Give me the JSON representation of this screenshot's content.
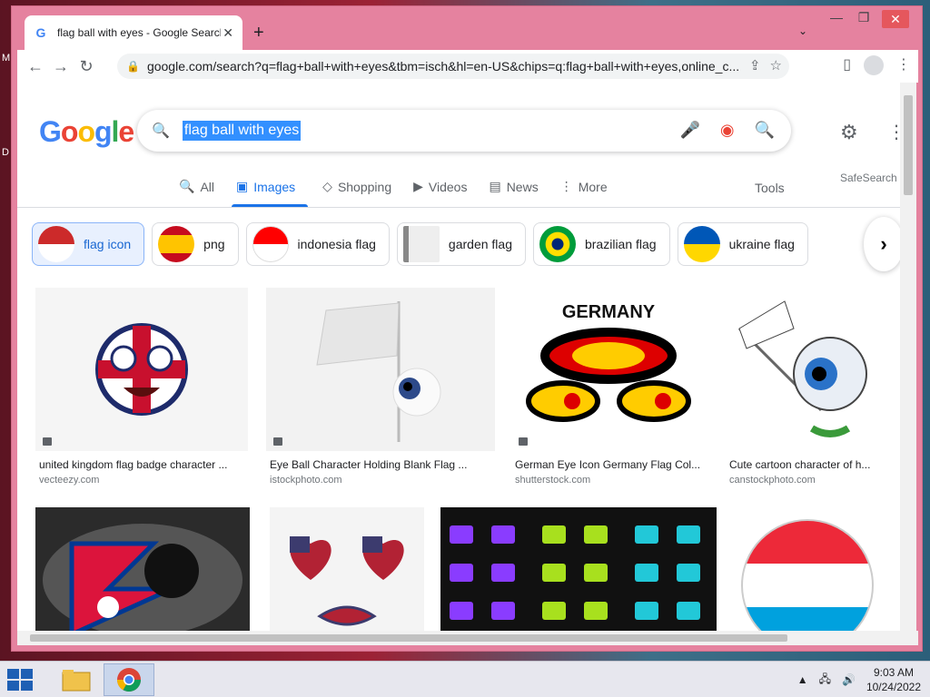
{
  "desktop": {
    "glyph_1": "M",
    "glyph_2": "D"
  },
  "browser": {
    "tab_title": "flag ball with eyes - Google Search",
    "tab_close": "✕",
    "new_tab": "+",
    "tab_search": "⌄",
    "window_controls": {
      "minimize": "—",
      "maximize": "❐",
      "close": "✕"
    },
    "nav": {
      "back": "←",
      "forward": "→",
      "reload": "↻"
    },
    "url": "google.com/search?q=flag+ball+with+eyes&tbm=isch&hl=en-US&chips=q:flag+ball+with+eyes,online_c...",
    "lock": "🔒",
    "omni_icons": [
      "⇪",
      "☆"
    ],
    "sidebar_icon": "▯",
    "menu_icon": "⋮"
  },
  "google": {
    "logo_letters": [
      "G",
      "o",
      "o",
      "g",
      "l",
      "e"
    ],
    "logo_colors": [
      "#4285f4",
      "#ea4335",
      "#fbbc05",
      "#4285f4",
      "#34a853",
      "#ea4335"
    ],
    "search_query": "flag ball with eyes",
    "search_icon": "🔍",
    "mic_icon": "🎤",
    "lens_icon": "◉",
    "submit_icon": "🔍",
    "settings_icon": "⚙",
    "apps_icon": "⋮⋮",
    "tabs": [
      {
        "icon": "🔍",
        "label": "All"
      },
      {
        "icon": "▣",
        "label": "Images"
      },
      {
        "icon": "◇",
        "label": "Shopping"
      },
      {
        "icon": "▶",
        "label": "Videos"
      },
      {
        "icon": "▤",
        "label": "News"
      },
      {
        "icon": "⋮",
        "label": "More"
      }
    ],
    "tools_label": "Tools",
    "safesearch_label": "SafeSearch",
    "chips": [
      {
        "label": "flag icon",
        "colors": [
          "#cc2a2a",
          "#ffffff"
        ]
      },
      {
        "label": "png",
        "colors": [
          "#c60b1e",
          "#ffc400"
        ]
      },
      {
        "label": "indonesia flag",
        "colors": [
          "#ff0000",
          "#ffffff"
        ]
      },
      {
        "label": "garden flag",
        "colors": [
          "#888888",
          "#eeeeee"
        ]
      },
      {
        "label": "brazilian flag",
        "colors": [
          "#009c3b",
          "#ffdf00"
        ]
      },
      {
        "label": "ukraine flag",
        "colors": [
          "#0057b7",
          "#ffd700"
        ]
      }
    ],
    "chip_next": "›",
    "results_row1": [
      {
        "title": "united kingdom flag badge character ...",
        "source": "vecteezy.com"
      },
      {
        "title": "Eye Ball Character Holding Blank Flag ...",
        "source": "istockphoto.com"
      },
      {
        "title": "German Eye Icon Germany Flag Col...",
        "source": "shutterstock.com"
      },
      {
        "title": "Cute cartoon character of h...",
        "source": "canstockphoto.com"
      }
    ],
    "image_texts": {
      "germany": "GERMANY"
    }
  },
  "taskbar": {
    "time": "9:03 AM",
    "date": "10/24/2022",
    "tray_icons": [
      "▲",
      "🖧",
      "🔊"
    ]
  }
}
